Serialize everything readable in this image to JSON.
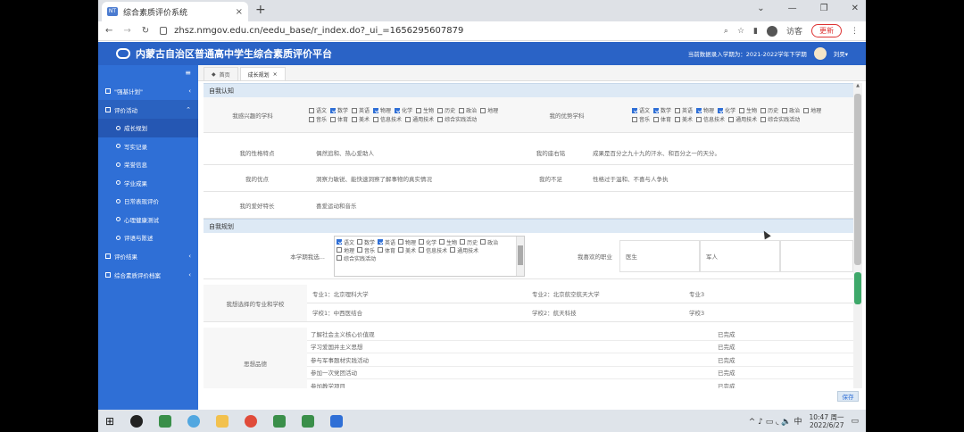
{
  "browser": {
    "tab_title": "综合素质评价系统",
    "tab_close": "×",
    "new_tab": "+",
    "url": "zhsz.nmgov.edu.cn/eedu_base/r_index.do?_ui_=1656295607879",
    "guest_label": "访客",
    "update_label": "更新",
    "win_controls": [
      "⌄",
      "—",
      "❐",
      "✕"
    ]
  },
  "app": {
    "title": "内蒙古自治区普通高中学生综合素质评价平台",
    "term_info": "当前数据录入学期为：2021-2022学年下学期",
    "user_name": "刘昊▾"
  },
  "sidebar": {
    "toggle": "≡",
    "items": [
      {
        "label": "\"强基计划\"",
        "chev": "‹"
      },
      {
        "label": "评价活动",
        "chev": "⌃"
      }
    ],
    "sub_items": [
      "成长规划",
      "写实记录",
      "荣誉信息",
      "学业成果",
      "日常表现评价",
      "心理健康测试",
      "评语与陈述"
    ],
    "items_after": [
      {
        "label": "评价结果",
        "chev": "‹"
      },
      {
        "label": "综合素质评价档案",
        "chev": "‹"
      }
    ]
  },
  "content_tabs": [
    {
      "label": "首页",
      "icon": "home-icon"
    },
    {
      "label": "成长规划",
      "close": "×"
    }
  ],
  "self_awareness": {
    "section_title": "自我认知",
    "interest_label": "我感兴趣的学科",
    "interest_subjects": [
      {
        "name": "语文",
        "checked": false
      },
      {
        "name": "数学",
        "checked": true
      },
      {
        "name": "英语",
        "checked": false
      },
      {
        "name": "物理",
        "checked": true
      },
      {
        "name": "化学",
        "checked": true
      },
      {
        "name": "生物",
        "checked": false
      },
      {
        "name": "历史",
        "checked": false
      },
      {
        "name": "政治",
        "checked": false
      },
      {
        "name": "地理",
        "checked": false
      },
      {
        "name": "音乐",
        "checked": false
      },
      {
        "name": "体育",
        "checked": false
      },
      {
        "name": "美术",
        "checked": false
      },
      {
        "name": "信息技术",
        "checked": false
      },
      {
        "name": "通用技术",
        "checked": false
      },
      {
        "name": "综合实践活动",
        "checked": false
      }
    ],
    "strong_label": "我的优势学科",
    "strong_subjects": [
      {
        "name": "语文",
        "checked": true
      },
      {
        "name": "数学",
        "checked": true
      },
      {
        "name": "英语",
        "checked": false
      },
      {
        "name": "物理",
        "checked": true
      },
      {
        "name": "化学",
        "checked": true
      },
      {
        "name": "生物",
        "checked": false
      },
      {
        "name": "历史",
        "checked": false
      },
      {
        "name": "政治",
        "checked": false
      },
      {
        "name": "地理",
        "checked": false
      },
      {
        "name": "音乐",
        "checked": false
      },
      {
        "name": "体育",
        "checked": false
      },
      {
        "name": "美术",
        "checked": false
      },
      {
        "name": "信息技术",
        "checked": false
      },
      {
        "name": "通用技术",
        "checked": false
      },
      {
        "name": "综合实践活动",
        "checked": false
      }
    ],
    "traits_label": "我的性格特点",
    "traits_value": "偶然追和、热心爱助人",
    "motto_label": "我的座右铭",
    "motto_value": "成果是百分之九十九的汗水、和百分之一的天分。",
    "strengths_label": "我的优点",
    "strengths_value": "洞察力敏锐、能快速洞察了解事物的真实情况",
    "weakness_label": "我的不足",
    "weakness_value": "性格过于温和、不喜与人争执",
    "hobbies_label": "我的爱好特长",
    "hobbies_value": "喜爱运动和音乐"
  },
  "self_planning": {
    "section_title": "自我规划",
    "select_label": "本学期我选...",
    "select_subjects": [
      {
        "name": "语文",
        "checked": true
      },
      {
        "name": "数学",
        "checked": false
      },
      {
        "name": "英语",
        "checked": true
      },
      {
        "name": "物理",
        "checked": false
      },
      {
        "name": "化学",
        "checked": false
      },
      {
        "name": "生物",
        "checked": false
      },
      {
        "name": "历史",
        "checked": false
      },
      {
        "name": "政治",
        "checked": false
      },
      {
        "name": "地理",
        "checked": false
      },
      {
        "name": "音乐",
        "checked": false
      },
      {
        "name": "体育",
        "checked": false
      },
      {
        "name": "美术",
        "checked": false
      },
      {
        "name": "信息技术",
        "checked": false
      },
      {
        "name": "通用技术",
        "checked": false
      },
      {
        "name": "综合实践活动",
        "checked": false
      }
    ],
    "job_label": "我喜欢的职业",
    "job1": "医生",
    "job2": "军人",
    "major_school_label": "我想选择的专业和学校",
    "major1_label": "专业1",
    "major1": "北京理科大学",
    "major2_label": "专业2",
    "major2": "北京航空航天大学",
    "major3_label": "专业3",
    "major3": "",
    "school1_label": "学校1",
    "school1": "中西医结合",
    "school2_label": "学校2",
    "school2": "航天科技",
    "school3_label": "学校3",
    "school3": "",
    "moral_label": "思想品德",
    "tasks": [
      {
        "name": "了解社会主义核心价值观",
        "status": "已完成"
      },
      {
        "name": "学习爱国并主义思想",
        "status": "已完成"
      },
      {
        "name": "参与军事题材实践活动",
        "status": "已完成"
      },
      {
        "name": "参加一次党团活动",
        "status": "已完成"
      },
      {
        "name": "参加教学项目",
        "status": "已完成"
      }
    ],
    "save_label": "保存"
  },
  "taskbar": {
    "time": "10:47 周一",
    "date": "2022/6/27",
    "tray_icons": "^ ♪ ▭ ◟ 🔈 中"
  },
  "colors": {
    "header_blue": "#2a63c6",
    "sidebar_blue": "#2f6fd6",
    "section_bg": "#dde9f5"
  }
}
